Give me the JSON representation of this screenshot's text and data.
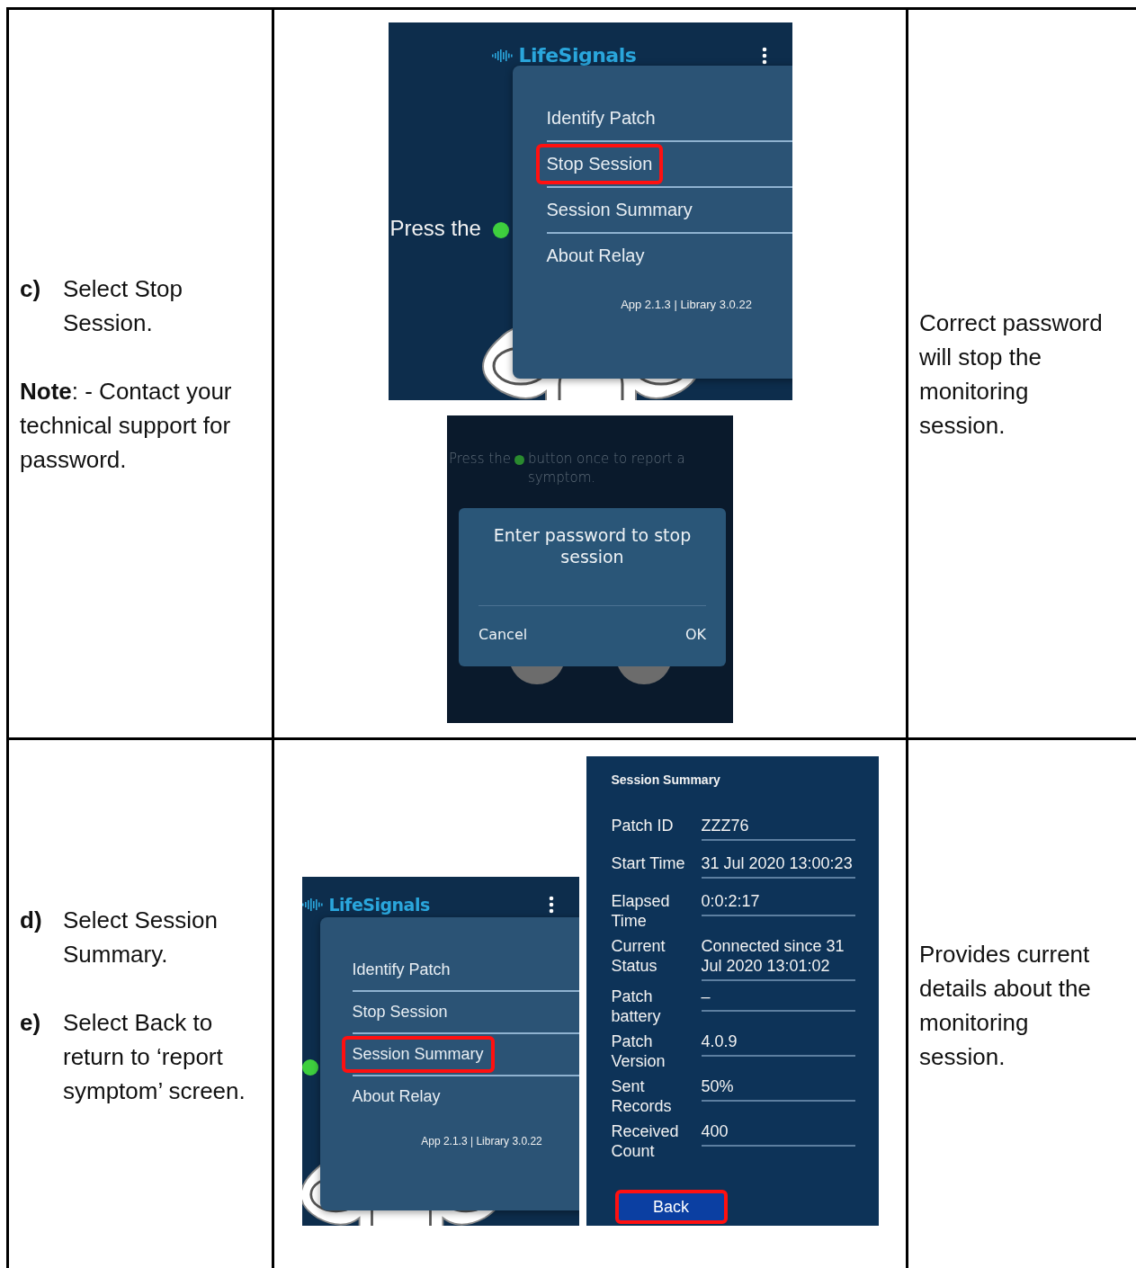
{
  "rows": [
    {
      "steps": [
        {
          "marker": "c)",
          "text": "Select Stop Session."
        }
      ],
      "note": "**Note**: - Contact your technical support for password.",
      "screens": [
        {
          "kind": "menu",
          "app_name": "LifeSignals",
          "background_text": "Press the",
          "items": [
            {
              "label": "Identify Patch",
              "highlighted": false
            },
            {
              "label": "Stop Session",
              "highlighted": true
            },
            {
              "label": "Session Summary",
              "highlighted": false
            },
            {
              "label": "About Relay",
              "highlighted": false
            }
          ],
          "version": "App 2.1.3 | Library 3.0.22"
        },
        {
          "kind": "dialog",
          "background_text": [
            "Press the",
            "button once to report a symptom."
          ],
          "title": "Enter password to stop session",
          "buttons": [
            "Cancel",
            "OK"
          ]
        }
      ],
      "description": "Correct password will stop the monitoring session."
    },
    {
      "steps": [
        {
          "marker": "d)",
          "text": "Select Session Summary."
        },
        {
          "marker": "e)",
          "text": "Select Back to return to ‘report symptom’ screen."
        }
      ],
      "screens": [
        {
          "kind": "menu",
          "app_name": "LifeSignals",
          "items": [
            {
              "label": "Identify Patch",
              "highlighted": false
            },
            {
              "label": "Stop Session",
              "highlighted": false
            },
            {
              "label": "Session Summary",
              "highlighted": true
            },
            {
              "label": "About Relay",
              "highlighted": false
            }
          ],
          "version": "App 2.1.3 | Library 3.0.22"
        },
        {
          "kind": "summary",
          "title": "Session Summary",
          "fields": [
            {
              "label": "Patch ID",
              "value": "ZZZ76"
            },
            {
              "label": "Start Time",
              "value": "31 Jul 2020 13:00:23"
            },
            {
              "label": "Elapsed Time",
              "value": "0:0:2:17"
            },
            {
              "label": "Current Status",
              "value": "Connected since 31 Jul 2020 13:01:02"
            },
            {
              "label": "Patch battery",
              "value": "–"
            },
            {
              "label": "Patch Version",
              "value": "4.0.9"
            },
            {
              "label": "Sent Records",
              "value": "50%"
            },
            {
              "label": "Received Count",
              "value": "400"
            }
          ],
          "back_button": {
            "label": "Back",
            "highlighted": true
          }
        }
      ],
      "description": "Provides current details about the monitoring session."
    }
  ]
}
